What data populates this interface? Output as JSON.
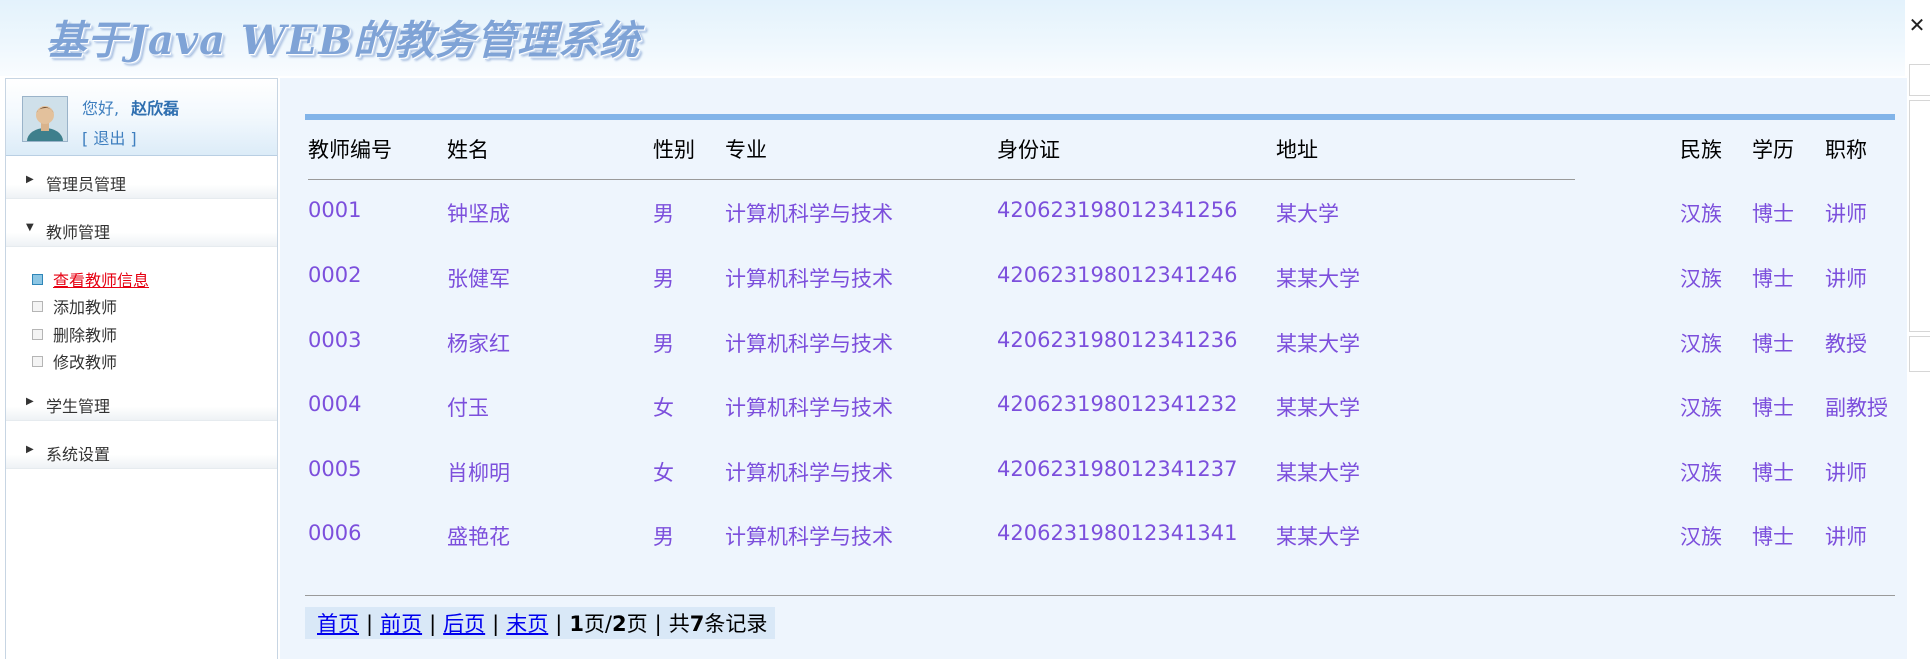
{
  "header": {
    "title": "基于Java WEB的教务管理系统"
  },
  "user": {
    "greeting": "您好,",
    "name": "赵欣磊",
    "logout": "[ 退出 ]"
  },
  "sidebar": {
    "groups": [
      {
        "label": "管理员管理",
        "expanded": false
      },
      {
        "label": "教师管理",
        "expanded": true,
        "items": [
          "查看教师信息",
          "添加教师",
          "删除教师",
          "修改教师"
        ]
      },
      {
        "label": "学生管理",
        "expanded": false
      },
      {
        "label": "系统设置",
        "expanded": false
      }
    ],
    "active_item": "查看教师信息"
  },
  "table": {
    "headers": [
      "教师编号",
      "姓名",
      "性别",
      "专业",
      "身份证",
      "地址",
      "民族",
      "学历",
      "职称"
    ],
    "rows": [
      [
        "0001",
        "钟坚成",
        "男",
        "计算机科学与技术",
        "420623198012341256",
        "某大学",
        "汉族",
        "博士",
        "讲师"
      ],
      [
        "0002",
        "张健军",
        "男",
        "计算机科学与技术",
        "420623198012341246",
        "某某大学",
        "汉族",
        "博士",
        "讲师"
      ],
      [
        "0003",
        "杨家红",
        "男",
        "计算机科学与技术",
        "420623198012341236",
        "某某大学",
        "汉族",
        "博士",
        "教授"
      ],
      [
        "0004",
        "付玉",
        "女",
        "计算机科学与技术",
        "420623198012341232",
        "某某大学",
        "汉族",
        "博士",
        "副教授"
      ],
      [
        "0005",
        "肖柳明",
        "女",
        "计算机科学与技术",
        "420623198012341237",
        "某某大学",
        "汉族",
        "博士",
        "讲师"
      ],
      [
        "0006",
        "盛艳花",
        "男",
        "计算机科学与技术",
        "420623198012341341",
        "某某大学",
        "汉族",
        "博士",
        "讲师"
      ]
    ]
  },
  "pager": {
    "first": "首页",
    "prev": "前页",
    "next": "后页",
    "last": "末页",
    "current_page": "1",
    "total_pages": "2",
    "page_word": "页",
    "page_sep": "页/",
    "total_prefix": "共",
    "total_records": "7",
    "total_suffix": "条记录",
    "divider": "|"
  },
  "colors": {
    "accent_bar": "#82b4e9",
    "cell_text": "#7c4fdc",
    "active_menu": "#e60012",
    "main_bg": "#eef5fd"
  },
  "icons": [
    "close-icon",
    "avatar-icon",
    "caret-right-icon",
    "caret-down-icon",
    "checkbox-icon"
  ]
}
